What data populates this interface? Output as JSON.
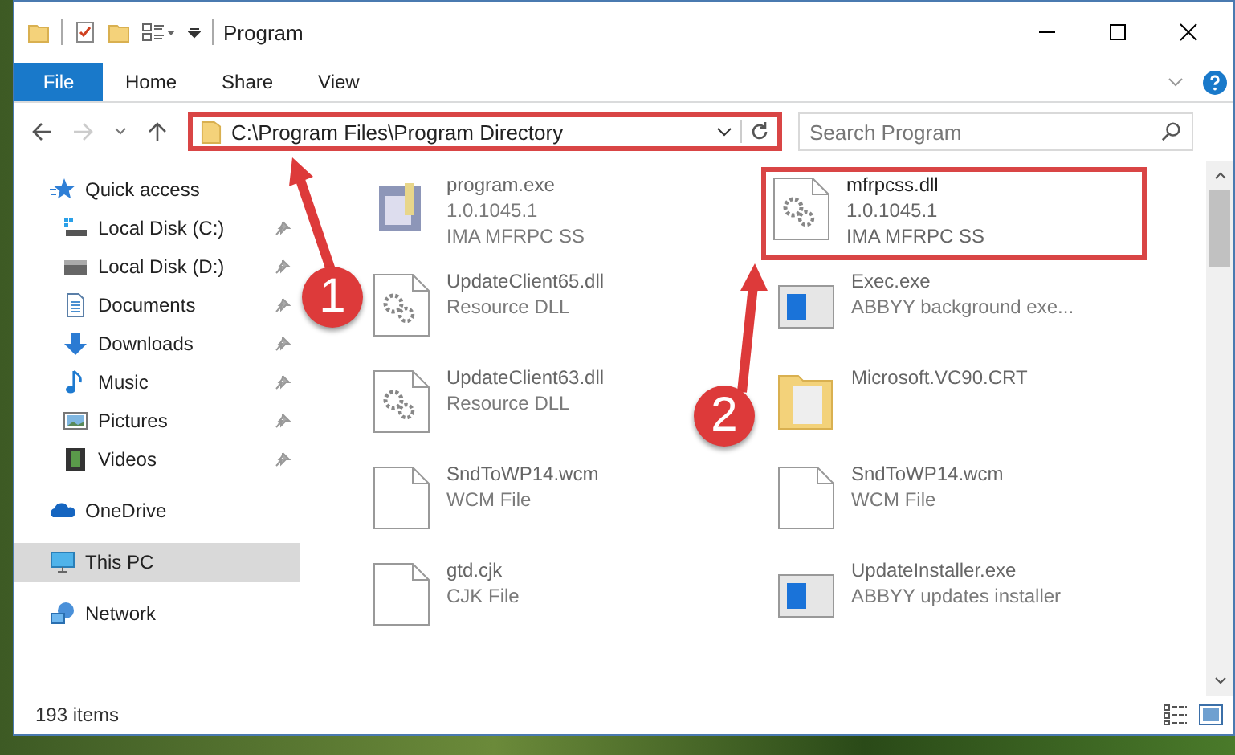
{
  "window": {
    "title": "Program"
  },
  "ribbon": {
    "tabs": [
      {
        "label": "File",
        "selected": true
      },
      {
        "label": "Home",
        "selected": false
      },
      {
        "label": "Share",
        "selected": false
      },
      {
        "label": "View",
        "selected": false
      }
    ]
  },
  "address_bar": {
    "path": "C:\\Program Files\\Program Directory",
    "highlighted": true
  },
  "search": {
    "placeholder": "Search Program"
  },
  "sidebar": {
    "items": [
      {
        "label": "Quick access",
        "kind": "star",
        "selected": false,
        "children": [
          {
            "label": "Local Disk (C:)",
            "kind": "disk-c",
            "pinned": true,
            "selected": false
          },
          {
            "label": "Local Disk (D:)",
            "kind": "disk",
            "pinned": true,
            "selected": false
          },
          {
            "label": "Documents",
            "kind": "documents",
            "pinned": true,
            "selected": false
          },
          {
            "label": "Downloads",
            "kind": "downloads",
            "pinned": true,
            "selected": false
          },
          {
            "label": "Music",
            "kind": "music",
            "pinned": true,
            "selected": false
          },
          {
            "label": "Pictures",
            "kind": "pictures",
            "pinned": true,
            "selected": false
          },
          {
            "label": "Videos",
            "kind": "videos",
            "pinned": true,
            "selected": false
          }
        ]
      },
      {
        "label": "OneDrive",
        "kind": "cloud",
        "selected": false
      },
      {
        "label": "This PC",
        "kind": "pc",
        "selected": true
      },
      {
        "label": "Network",
        "kind": "network",
        "selected": false
      }
    ]
  },
  "files": [
    {
      "name": "program.exe",
      "lines": [
        "1.0.1045.1",
        "IMA MFRPC SS"
      ],
      "kind": "exe",
      "blurred": true,
      "highlighted": false
    },
    {
      "name": "mfrpcss.dll",
      "lines": [
        "1.0.1045.1",
        "IMA MFRPC SS"
      ],
      "kind": "dll",
      "blurred": false,
      "highlighted": true
    },
    {
      "name": "UpdateClient65.dll",
      "lines": [
        "Resource DLL"
      ],
      "kind": "dll",
      "blurred": true,
      "highlighted": false
    },
    {
      "name": "Exec.exe",
      "lines": [
        "ABBYY background exe..."
      ],
      "kind": "app",
      "blurred": true,
      "highlighted": false
    },
    {
      "name": "UpdateClient63.dll",
      "lines": [
        "Resource DLL"
      ],
      "kind": "dll",
      "blurred": true,
      "highlighted": false
    },
    {
      "name": "Microsoft.VC90.CRT",
      "kind": "folder",
      "blurred": true,
      "highlighted": false
    },
    {
      "name": "SndToWP14.wcm",
      "lines": [
        "WCM File"
      ],
      "kind": "doc",
      "blurred": true,
      "highlighted": false
    },
    {
      "name": "SndToWP14.wcm",
      "lines": [
        "WCM File"
      ],
      "kind": "doc",
      "blurred": true,
      "highlighted": false
    },
    {
      "name": "gtd.cjk",
      "lines": [
        "CJK File"
      ],
      "kind": "doc",
      "blurred": true,
      "highlighted": false
    },
    {
      "name": "UpdateInstaller.exe",
      "lines": [
        "ABBYY updates installer"
      ],
      "kind": "app",
      "blurred": true,
      "highlighted": false
    }
  ],
  "status_bar": {
    "count": "193 items"
  },
  "annotations": [
    {
      "number": "1"
    },
    {
      "number": "2"
    }
  ]
}
